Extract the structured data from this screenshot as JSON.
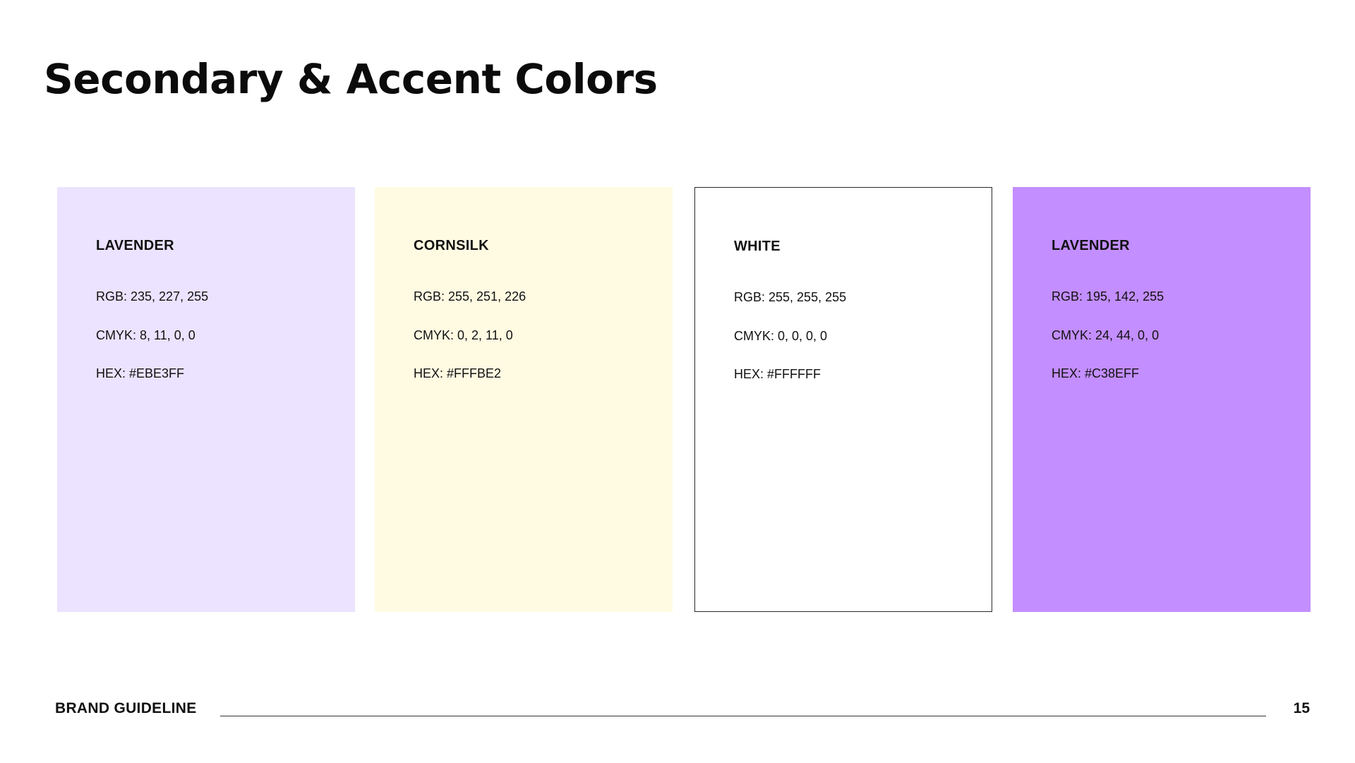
{
  "title": "Secondary & Accent Colors",
  "swatches": [
    {
      "name": "LAVENDER",
      "rgb": "RGB: 235, 227, 255",
      "cmyk": "CMYK: 8, 11, 0, 0",
      "hex": "HEX: #EBE3FF",
      "color": "#EBE3FF"
    },
    {
      "name": "CORNSILK",
      "rgb": "RGB: 255, 251, 226",
      "cmyk": "CMYK: 0, 2, 11, 0",
      "hex": "HEX: #FFFBE2",
      "color": "#FFFBE2"
    },
    {
      "name": "WHITE",
      "rgb": "RGB: 255, 255, 255",
      "cmyk": "CMYK: 0, 0, 0, 0",
      "hex": "HEX: #FFFFFF",
      "color": "#FFFFFF"
    },
    {
      "name": "LAVENDER",
      "rgb": "RGB: 195, 142, 255",
      "cmyk": "CMYK: 24, 44, 0, 0",
      "hex": "HEX: #C38EFF",
      "color": "#C38EFF"
    }
  ],
  "footer": {
    "label": "BRAND GUIDELINE",
    "page_number": "15"
  }
}
